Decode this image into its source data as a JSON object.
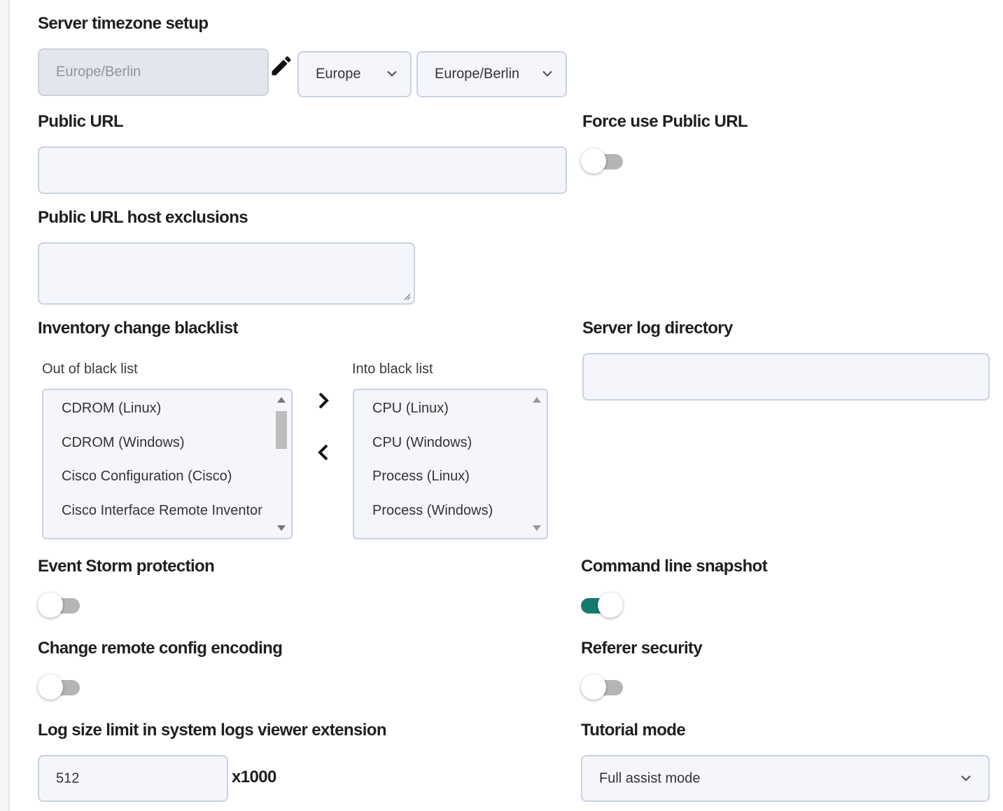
{
  "timezone": {
    "label": "Server timezone setup",
    "current_value": "Europe/Berlin",
    "region_select": "Europe",
    "zone_select": "Europe/Berlin"
  },
  "public_url": {
    "label": "Public URL",
    "value": ""
  },
  "force_public_url": {
    "label": "Force use Public URL",
    "enabled": false
  },
  "public_url_exclusions": {
    "label": "Public URL host exclusions",
    "value": ""
  },
  "inventory_blacklist": {
    "label": "Inventory change blacklist",
    "out_label": "Out of black list",
    "into_label": "Into black list",
    "out_items": [
      "CDROM (Linux)",
      "CDROM (Windows)",
      "Cisco Configuration (Cisco)",
      "Cisco Interface Remote Inventor"
    ],
    "into_items": [
      "CPU (Linux)",
      "CPU (Windows)",
      "Process (Linux)",
      "Process (Windows)"
    ]
  },
  "server_log_directory": {
    "label": "Server log directory",
    "value": ""
  },
  "event_storm": {
    "label": "Event Storm protection",
    "enabled": false
  },
  "command_line_snapshot": {
    "label": "Command line snapshot",
    "enabled": true
  },
  "remote_config_encoding": {
    "label": "Change remote config encoding",
    "enabled": false
  },
  "referer_security": {
    "label": "Referer security",
    "enabled": false
  },
  "log_size_limit": {
    "label": "Log size limit in system logs viewer extension",
    "value": "512",
    "suffix": "x1000"
  },
  "tutorial_mode": {
    "label": "Tutorial mode",
    "selected": "Full assist mode"
  },
  "colors": {
    "toggle_on": "#147a6c",
    "toggle_off": "#b5b5b5",
    "field_bg": "#f4f6fb",
    "field_border": "#c9d2e0"
  }
}
